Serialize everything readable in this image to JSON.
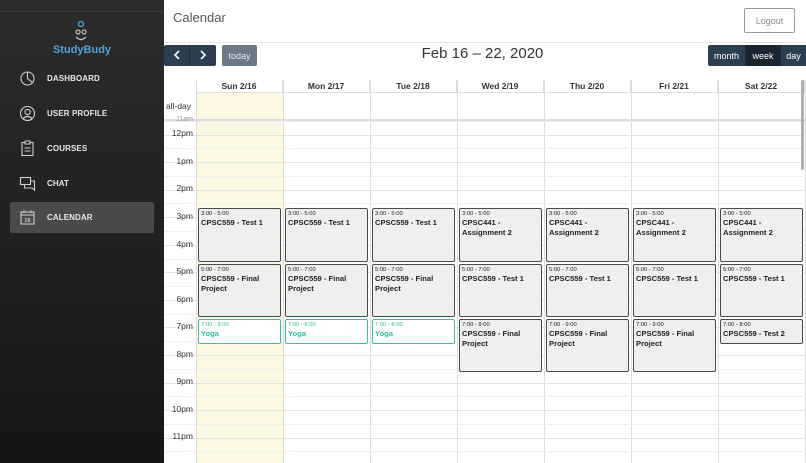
{
  "brand": {
    "name": "StudyBudy"
  },
  "nav": [
    {
      "label": "DASHBOARD",
      "icon": "dashboard-icon"
    },
    {
      "label": "USER PROFILE",
      "icon": "user-profile-icon"
    },
    {
      "label": "COURSES",
      "icon": "clipboard-icon"
    },
    {
      "label": "CHAT",
      "icon": "chat-icon"
    },
    {
      "label": "CALENDAR",
      "icon": "calendar-icon",
      "active": true
    }
  ],
  "header": {
    "title": "Calendar",
    "logout_label": "Logout"
  },
  "toolbar": {
    "prev_label": "‹",
    "next_label": "›",
    "today_label": "today",
    "date_range": "Feb 16 – 22, 2020",
    "views": {
      "month": "month",
      "week": "week",
      "day": "day"
    },
    "active_view": "week"
  },
  "calendar": {
    "allday_label": "all-day",
    "days": [
      "Sun 2/16",
      "Mon 2/17",
      "Tue 2/18",
      "Wed 2/19",
      "Thu 2/20",
      "Fri 2/21",
      "Sat 2/22"
    ],
    "times": [
      "11am",
      "12pm",
      "1pm",
      "2pm",
      "3pm",
      "4pm",
      "5pm",
      "6pm",
      "7pm",
      "8pm",
      "9pm",
      "10pm",
      "11pm"
    ],
    "events": [
      {
        "day": 0,
        "time": "3:00 - 5:00",
        "title": "CPSC559 - Test 1"
      },
      {
        "day": 0,
        "time": "5:00 - 7:00",
        "title": "CPSC559 - Final Project"
      },
      {
        "day": 0,
        "time": "7:00 - 8:00",
        "title": "Yoga",
        "style": "yoga"
      },
      {
        "day": 1,
        "time": "3:00 - 5:00",
        "title": "CPSC559 - Test 1"
      },
      {
        "day": 1,
        "time": "5:00 - 7:00",
        "title": "CPSC559 - Final Project"
      },
      {
        "day": 1,
        "time": "7:00 - 8:00",
        "title": "Yoga",
        "style": "yoga"
      },
      {
        "day": 2,
        "time": "3:00 - 5:00",
        "title": "CPSC559 - Test 1"
      },
      {
        "day": 2,
        "time": "5:00 - 7:00",
        "title": "CPSC559 - Final Project"
      },
      {
        "day": 2,
        "time": "7:00 - 8:00",
        "title": "Yoga",
        "style": "yoga"
      },
      {
        "day": 3,
        "time": "3:00 - 5:00",
        "title": "CPSC441 - Assignment 2"
      },
      {
        "day": 3,
        "time": "5:00 - 7:00",
        "title": "CPSC559 - Test 1"
      },
      {
        "day": 3,
        "time": "7:00 - 9:00",
        "title": "CPSC559 - Final Project"
      },
      {
        "day": 4,
        "time": "3:00 - 5:00",
        "title": "CPSC441 - Assignment 2"
      },
      {
        "day": 4,
        "time": "5:00 - 7:00",
        "title": "CPSC559 - Test 1"
      },
      {
        "day": 4,
        "time": "7:00 - 9:00",
        "title": "CPSC559 - Final Project"
      },
      {
        "day": 5,
        "time": "3:00 - 5:00",
        "title": "CPSC441 - Assignment 2"
      },
      {
        "day": 5,
        "time": "5:00 - 7:00",
        "title": "CPSC559 - Test 1"
      },
      {
        "day": 5,
        "time": "7:00 - 9:00",
        "title": "CPSC559 - Final Project"
      },
      {
        "day": 6,
        "time": "3:00 - 5:00",
        "title": "CPSC441 - Assignment 2"
      },
      {
        "day": 6,
        "time": "5:00 - 7:00",
        "title": "CPSC559 - Test 1"
      },
      {
        "day": 6,
        "time": "7:00 - 8:00",
        "title": "CPSC559 - Test 2"
      }
    ]
  },
  "colors": {
    "today_highlight": "#fcf8e3",
    "toolbar": "#2c3e50",
    "yoga": "#2fbf9f",
    "brand": "#4fa3d8"
  }
}
